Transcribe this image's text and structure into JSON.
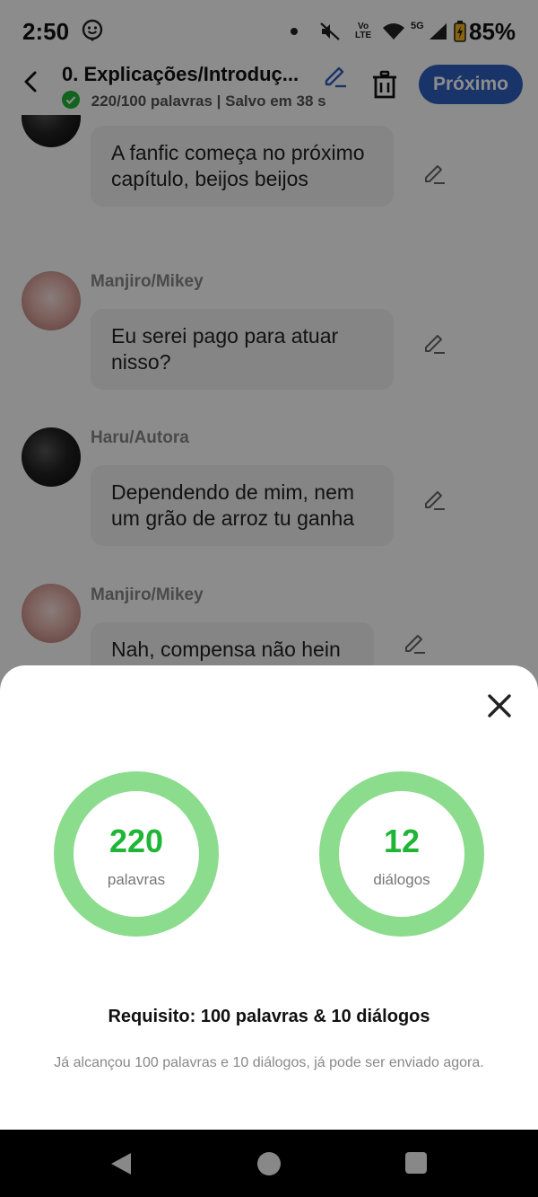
{
  "status_bar": {
    "time": "2:50",
    "network_volte_top": "Vo",
    "network_volte_bottom": "LTE",
    "network_5g": "5G",
    "battery": "85%"
  },
  "header": {
    "title": "0. Explicações/Introduç...",
    "word_count": "220/100 palavras",
    "separator": "|",
    "saved_status": "Salvo em 38 s",
    "next_label": "Próximo"
  },
  "messages": [
    {
      "speaker": "",
      "avatar": "dark",
      "text": "A fanfic começa no próximo capítulo, beijos beijos"
    },
    {
      "speaker": "Manjiro/Mikey",
      "avatar": "pink",
      "text": "Eu serei pago para atuar nisso?"
    },
    {
      "speaker": "Haru/Autora",
      "avatar": "dark",
      "text": "Dependendo de mim, nem um grão de arroz tu ganha"
    },
    {
      "speaker": "Manjiro/Mikey",
      "avatar": "pink",
      "text": "Nah, compensa não hein"
    }
  ],
  "stats_sheet": {
    "words": {
      "value": "220",
      "label": "palavras"
    },
    "dialogs": {
      "value": "12",
      "label": "diálogos"
    },
    "requirement": "Requisito: 100 palavras & 10 diálogos",
    "note": "Já alcançou 100 palavras e 10 diálogos, já pode ser enviado agora."
  },
  "colors": {
    "accent_blue": "#2f5fc0",
    "ring_green": "#8bdc8c",
    "value_green": "#1fb536"
  },
  "icons": [
    "back-arrow-icon",
    "pencil-icon",
    "trash-icon",
    "check-circle-icon",
    "close-icon"
  ]
}
